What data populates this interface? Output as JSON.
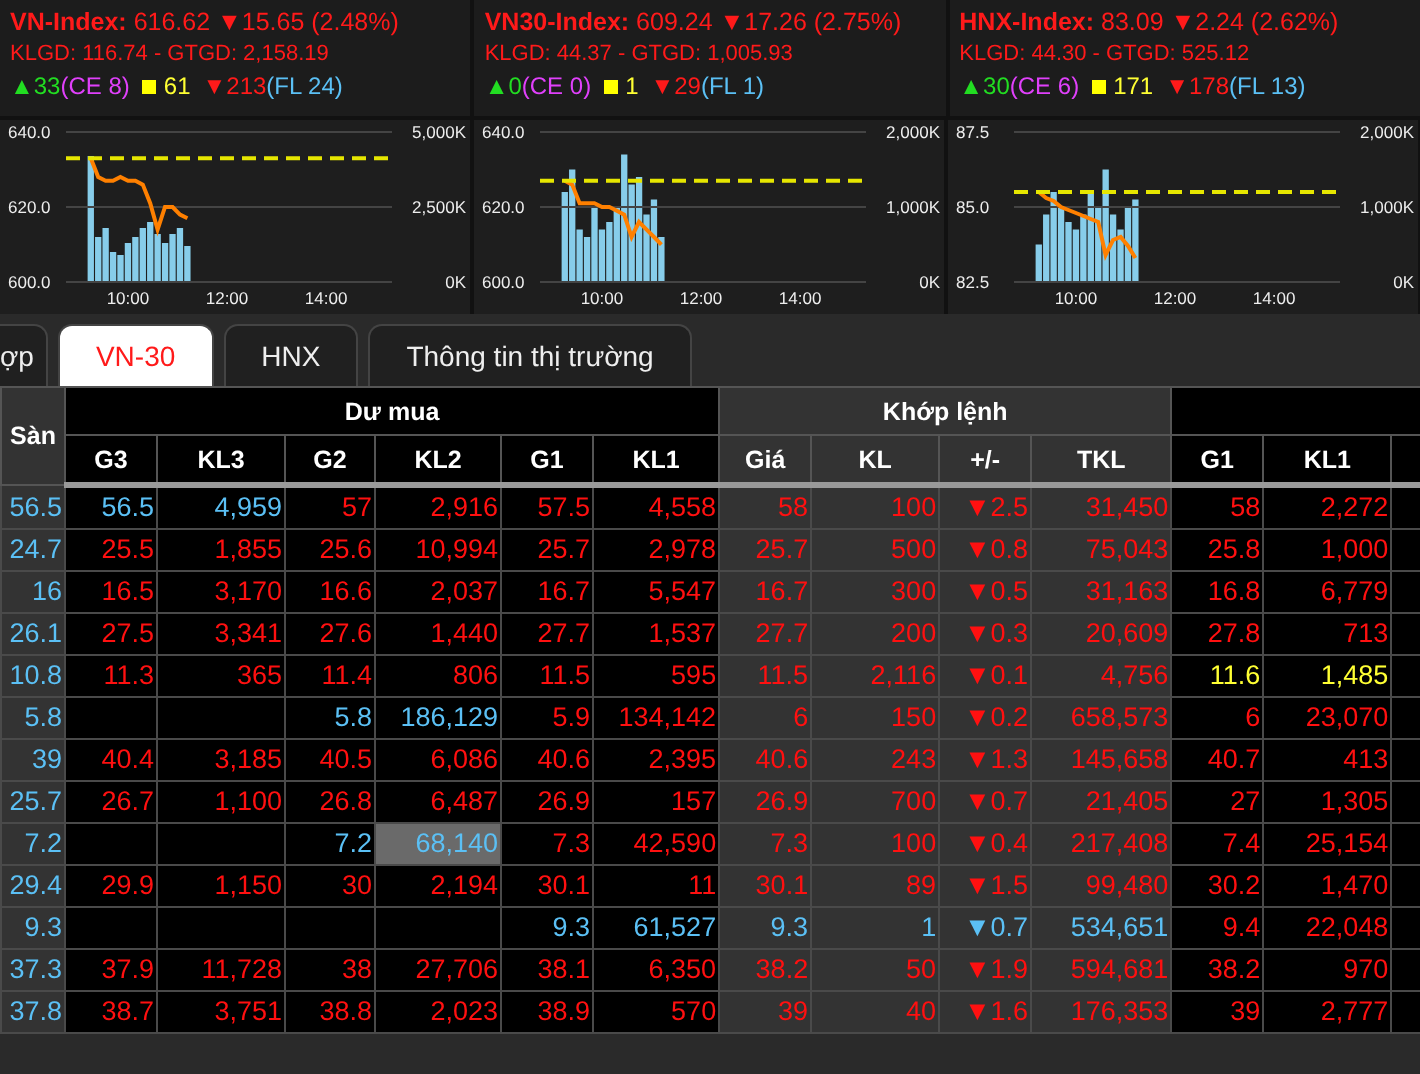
{
  "indices": [
    {
      "name": "VN-Index:",
      "value": "616.62",
      "change": "▼15.65 (2.48%)",
      "volume_line": "KLGD: 116.74 - GTGD: 2,158.19",
      "advances": "▲33",
      "ceiling": "(CE 8)",
      "unchanged": "61",
      "declines": "▼213",
      "floor": "(FL 24)"
    },
    {
      "name": "VN30-Index:",
      "value": "609.24",
      "change": "▼17.26 (2.75%)",
      "volume_line": "KLGD: 44.37 - GTGD: 1,005.93",
      "advances": "▲0",
      "ceiling": "(CE 0)",
      "unchanged": "1",
      "declines": "▼29",
      "floor": "(FL 1)"
    },
    {
      "name": "HNX-Index:",
      "value": "83.09",
      "change": "▼2.24 (2.62%)",
      "volume_line": "KLGD: 44.30 - GTGD: 525.12",
      "advances": "▲30",
      "ceiling": "(CE 6)",
      "unchanged": "171",
      "declines": "▼178",
      "floor": "(FL 13)"
    }
  ],
  "panels": [
    {
      "volume": {
        "chart_data": {
          "type": "bar",
          "x": [
            9.25,
            9.4,
            9.55,
            9.7,
            9.85,
            10.0,
            10.15,
            10.3,
            10.45,
            10.6,
            10.75,
            10.9,
            11.05,
            11.2
          ],
          "xlim": [
            8.75,
            15.33
          ],
          "ylim": [
            0,
            5000
          ],
          "yticks": [
            {
              "value": 0,
              "label": "0K"
            },
            {
              "value": 2500,
              "label": "2,500K"
            },
            {
              "value": 5000,
              "label": "5,000K"
            }
          ],
          "series": [
            {
              "color": "#87cdea",
              "values": [
                4200,
                1500,
                1800,
                1000,
                900,
                1300,
                1500,
                1800,
                2000,
                1600,
                1300,
                1600,
                1800,
                1200
              ]
            }
          ]
        }
      },
      "price": {
        "chart_data": {
          "type": "line",
          "x": [
            9.25,
            9.4,
            9.55,
            9.7,
            9.85,
            10.0,
            10.15,
            10.3,
            10.45,
            10.6,
            10.75,
            10.9,
            11.05,
            11.2
          ],
          "xlim": [
            8.75,
            15.33
          ],
          "ylim": [
            600,
            640
          ],
          "xticks": [
            {
              "value": 10,
              "label": "10:00"
            },
            {
              "value": 12,
              "label": "12:00"
            },
            {
              "value": 14,
              "label": "14:00"
            }
          ],
          "yticks": [
            {
              "value": 600,
              "label": "600.0"
            },
            {
              "value": 620,
              "label": "620.0"
            },
            {
              "value": 640,
              "label": "640.0"
            }
          ],
          "series": [
            {
              "color": "#ff8000",
              "values": [
                633,
                628,
                627,
                627,
                628,
                627,
                627,
                626,
                621,
                614,
                620,
                620,
                618,
                617
              ]
            }
          ]
        }
      }
    },
    {
      "volume": {
        "chart_data": {
          "type": "bar",
          "x": [
            9.25,
            9.4,
            9.55,
            9.7,
            9.85,
            10.0,
            10.15,
            10.3,
            10.45,
            10.6,
            10.75,
            10.9,
            11.05,
            11.2
          ],
          "xlim": [
            8.75,
            15.33
          ],
          "ylim": [
            0,
            2000
          ],
          "yticks": [
            {
              "value": 0,
              "label": "0K"
            },
            {
              "value": 1000,
              "label": "1,000K"
            },
            {
              "value": 2000,
              "label": "2,000K"
            }
          ],
          "series": [
            {
              "color": "#87cdea",
              "values": [
                1200,
                1500,
                700,
                600,
                1000,
                700,
                800,
                1000,
                1700,
                1300,
                1400,
                900,
                1100,
                600
              ]
            }
          ]
        }
      },
      "price": {
        "chart_data": {
          "type": "line",
          "x": [
            9.25,
            9.4,
            9.55,
            9.7,
            9.85,
            10.0,
            10.15,
            10.3,
            10.45,
            10.6,
            10.75,
            10.9,
            11.05,
            11.2
          ],
          "xlim": [
            8.75,
            15.33
          ],
          "ylim": [
            600,
            640
          ],
          "xticks": [
            {
              "value": 10,
              "label": "10:00"
            },
            {
              "value": 12,
              "label": "12:00"
            },
            {
              "value": 14,
              "label": "14:00"
            }
          ],
          "yticks": [
            {
              "value": 600,
              "label": "600.0"
            },
            {
              "value": 620,
              "label": "620.0"
            },
            {
              "value": 640,
              "label": "640.0"
            }
          ],
          "series": [
            {
              "color": "#ff8000",
              "values": [
                627,
                626,
                621,
                621,
                621,
                620,
                620,
                619,
                618,
                612,
                616,
                614,
                612,
                610
              ]
            }
          ]
        }
      }
    },
    {
      "volume": {
        "chart_data": {
          "type": "bar",
          "x": [
            9.25,
            9.4,
            9.55,
            9.7,
            9.85,
            10.0,
            10.15,
            10.3,
            10.45,
            10.6,
            10.75,
            10.9,
            11.05,
            11.2
          ],
          "xlim": [
            8.75,
            15.33
          ],
          "ylim": [
            0,
            2000
          ],
          "yticks": [
            {
              "value": 0,
              "label": "0K"
            },
            {
              "value": 1000,
              "label": "1,000K"
            },
            {
              "value": 2000,
              "label": "2,000K"
            }
          ],
          "series": [
            {
              "color": "#87cdea",
              "values": [
                500,
                900,
                1200,
                1000,
                800,
                700,
                900,
                1200,
                1000,
                1500,
                900,
                700,
                1000,
                1100
              ]
            }
          ]
        }
      },
      "price": {
        "chart_data": {
          "type": "line",
          "x": [
            9.25,
            9.4,
            9.55,
            9.7,
            9.85,
            10.0,
            10.15,
            10.3,
            10.45,
            10.6,
            10.75,
            10.9,
            11.05,
            11.2
          ],
          "xlim": [
            8.75,
            15.33
          ],
          "ylim": [
            82.5,
            87.5
          ],
          "xticks": [
            {
              "value": 10,
              "label": "10:00"
            },
            {
              "value": 12,
              "label": "12:00"
            },
            {
              "value": 14,
              "label": "14:00"
            }
          ],
          "yticks": [
            {
              "value": 82.5,
              "label": "82.5"
            },
            {
              "value": 85,
              "label": "85.0"
            },
            {
              "value": 87.5,
              "label": "87.5"
            }
          ],
          "series": [
            {
              "color": "#ff8000",
              "values": [
                85.5,
                85.3,
                85.2,
                85.0,
                84.9,
                84.8,
                84.7,
                84.6,
                84.5,
                83.4,
                83.9,
                84.0,
                83.7,
                83.3
              ]
            }
          ]
        }
      }
    }
  ],
  "tabs": [
    {
      "label": "ợp",
      "selected": false
    },
    {
      "label": "VN-30",
      "selected": true
    },
    {
      "label": "HNX",
      "selected": false
    },
    {
      "label": "Thông tin thị trường",
      "selected": false
    }
  ],
  "table": {
    "groups": [
      {
        "kind": "floor"
      },
      {
        "kind": "buy",
        "label": "Dư mua"
      },
      {
        "kind": "match",
        "label": "Khớp lệnh"
      },
      {
        "kind": "sell"
      }
    ],
    "columns": [
      {
        "label": "Sàn",
        "kind": "floor"
      },
      {
        "label": "G3",
        "kind": "buy"
      },
      {
        "label": "KL3",
        "kind": "buy"
      },
      {
        "label": "G2",
        "kind": "buy"
      },
      {
        "label": "KL2",
        "kind": "buy"
      },
      {
        "label": "G1",
        "kind": "buy"
      },
      {
        "label": "KL1",
        "kind": "buy"
      },
      {
        "label": "Giá",
        "kind": "match"
      },
      {
        "label": "KL",
        "kind": "match"
      },
      {
        "label": "+/-",
        "kind": "match"
      },
      {
        "label": "TKL",
        "kind": "match"
      },
      {
        "label": "G1",
        "kind": "sell"
      },
      {
        "label": "KL1",
        "kind": "sell"
      }
    ],
    "rows": [
      {
        "cells": [
          {
            "text": "56.5",
            "color": "#5bc0f5"
          },
          {
            "text": "56.5",
            "color": "#5bc0f5"
          },
          {
            "text": "4,959",
            "color": "#5bc0f5"
          },
          {
            "text": "57",
            "color": "#ff1010"
          },
          {
            "text": "2,916",
            "color": "#ff1010"
          },
          {
            "text": "57.5",
            "color": "#ff1010"
          },
          {
            "text": "4,558",
            "color": "#ff1010"
          },
          {
            "text": "58",
            "color": "#ff1010"
          },
          {
            "text": "100",
            "color": "#ff1010"
          },
          {
            "text": "▼2.5",
            "color": "#ff1010"
          },
          {
            "text": "31,450",
            "color": "#ff1010"
          },
          {
            "text": "58",
            "color": "#ff1010"
          },
          {
            "text": "2,272",
            "color": "#ff1010"
          }
        ]
      },
      {
        "cells": [
          {
            "text": "24.7",
            "color": "#5bc0f5"
          },
          {
            "text": "25.5",
            "color": "#ff1010"
          },
          {
            "text": "1,855",
            "color": "#ff1010"
          },
          {
            "text": "25.6",
            "color": "#ff1010"
          },
          {
            "text": "10,994",
            "color": "#ff1010"
          },
          {
            "text": "25.7",
            "color": "#ff1010"
          },
          {
            "text": "2,978",
            "color": "#ff1010"
          },
          {
            "text": "25.7",
            "color": "#ff1010"
          },
          {
            "text": "500",
            "color": "#ff1010"
          },
          {
            "text": "▼0.8",
            "color": "#ff1010"
          },
          {
            "text": "75,043",
            "color": "#ff1010"
          },
          {
            "text": "25.8",
            "color": "#ff1010"
          },
          {
            "text": "1,000",
            "color": "#ff1010"
          }
        ]
      },
      {
        "cells": [
          {
            "text": "16",
            "color": "#5bc0f5"
          },
          {
            "text": "16.5",
            "color": "#ff1010"
          },
          {
            "text": "3,170",
            "color": "#ff1010"
          },
          {
            "text": "16.6",
            "color": "#ff1010"
          },
          {
            "text": "2,037",
            "color": "#ff1010"
          },
          {
            "text": "16.7",
            "color": "#ff1010"
          },
          {
            "text": "5,547",
            "color": "#ff1010"
          },
          {
            "text": "16.7",
            "color": "#ff1010"
          },
          {
            "text": "300",
            "color": "#ff1010"
          },
          {
            "text": "▼0.5",
            "color": "#ff1010"
          },
          {
            "text": "31,163",
            "color": "#ff1010"
          },
          {
            "text": "16.8",
            "color": "#ff1010"
          },
          {
            "text": "6,779",
            "color": "#ff1010"
          }
        ]
      },
      {
        "cells": [
          {
            "text": "26.1",
            "color": "#5bc0f5"
          },
          {
            "text": "27.5",
            "color": "#ff1010"
          },
          {
            "text": "3,341",
            "color": "#ff1010"
          },
          {
            "text": "27.6",
            "color": "#ff1010"
          },
          {
            "text": "1,440",
            "color": "#ff1010"
          },
          {
            "text": "27.7",
            "color": "#ff1010"
          },
          {
            "text": "1,537",
            "color": "#ff1010"
          },
          {
            "text": "27.7",
            "color": "#ff1010"
          },
          {
            "text": "200",
            "color": "#ff1010"
          },
          {
            "text": "▼0.3",
            "color": "#ff1010"
          },
          {
            "text": "20,609",
            "color": "#ff1010"
          },
          {
            "text": "27.8",
            "color": "#ff1010"
          },
          {
            "text": "713",
            "color": "#ff1010"
          }
        ]
      },
      {
        "cells": [
          {
            "text": "10.8",
            "color": "#5bc0f5"
          },
          {
            "text": "11.3",
            "color": "#ff1010"
          },
          {
            "text": "365",
            "color": "#ff1010"
          },
          {
            "text": "11.4",
            "color": "#ff1010"
          },
          {
            "text": "806",
            "color": "#ff1010"
          },
          {
            "text": "11.5",
            "color": "#ff1010"
          },
          {
            "text": "595",
            "color": "#ff1010"
          },
          {
            "text": "11.5",
            "color": "#ff1010"
          },
          {
            "text": "2,116",
            "color": "#ff1010"
          },
          {
            "text": "▼0.1",
            "color": "#ff1010"
          },
          {
            "text": "4,756",
            "color": "#ff1010"
          },
          {
            "text": "11.6",
            "color": "#ffff33"
          },
          {
            "text": "1,485",
            "color": "#ffff33"
          }
        ]
      },
      {
        "cells": [
          {
            "text": "5.8",
            "color": "#5bc0f5"
          },
          null,
          null,
          {
            "text": "5.8",
            "color": "#5bc0f5"
          },
          {
            "text": "186,129",
            "color": "#5bc0f5"
          },
          {
            "text": "5.9",
            "color": "#ff1010"
          },
          {
            "text": "134,142",
            "color": "#ff1010"
          },
          {
            "text": "6",
            "color": "#ff1010"
          },
          {
            "text": "150",
            "color": "#ff1010"
          },
          {
            "text": "▼0.2",
            "color": "#ff1010"
          },
          {
            "text": "658,573",
            "color": "#ff1010"
          },
          {
            "text": "6",
            "color": "#ff1010"
          },
          {
            "text": "23,070",
            "color": "#ff1010"
          }
        ]
      },
      {
        "cells": [
          {
            "text": "39",
            "color": "#5bc0f5"
          },
          {
            "text": "40.4",
            "color": "#ff1010"
          },
          {
            "text": "3,185",
            "color": "#ff1010"
          },
          {
            "text": "40.5",
            "color": "#ff1010"
          },
          {
            "text": "6,086",
            "color": "#ff1010"
          },
          {
            "text": "40.6",
            "color": "#ff1010"
          },
          {
            "text": "2,395",
            "color": "#ff1010"
          },
          {
            "text": "40.6",
            "color": "#ff1010"
          },
          {
            "text": "243",
            "color": "#ff1010"
          },
          {
            "text": "▼1.3",
            "color": "#ff1010"
          },
          {
            "text": "145,658",
            "color": "#ff1010"
          },
          {
            "text": "40.7",
            "color": "#ff1010"
          },
          {
            "text": "413",
            "color": "#ff1010"
          }
        ]
      },
      {
        "cells": [
          {
            "text": "25.7",
            "color": "#5bc0f5"
          },
          {
            "text": "26.7",
            "color": "#ff1010"
          },
          {
            "text": "1,100",
            "color": "#ff1010"
          },
          {
            "text": "26.8",
            "color": "#ff1010"
          },
          {
            "text": "6,487",
            "color": "#ff1010"
          },
          {
            "text": "26.9",
            "color": "#ff1010"
          },
          {
            "text": "157",
            "color": "#ff1010"
          },
          {
            "text": "26.9",
            "color": "#ff1010"
          },
          {
            "text": "700",
            "color": "#ff1010"
          },
          {
            "text": "▼0.7",
            "color": "#ff1010"
          },
          {
            "text": "21,405",
            "color": "#ff1010"
          },
          {
            "text": "27",
            "color": "#ff1010"
          },
          {
            "text": "1,305",
            "color": "#ff1010"
          }
        ]
      },
      {
        "cells": [
          {
            "text": "7.2",
            "color": "#5bc0f5"
          },
          null,
          null,
          {
            "text": "7.2",
            "color": "#5bc0f5"
          },
          {
            "text": "68,140",
            "color": "#5bc0f5",
            "flash": true
          },
          {
            "text": "7.3",
            "color": "#ff1010"
          },
          {
            "text": "42,590",
            "color": "#ff1010"
          },
          {
            "text": "7.3",
            "color": "#ff1010"
          },
          {
            "text": "100",
            "color": "#ff1010"
          },
          {
            "text": "▼0.4",
            "color": "#ff1010"
          },
          {
            "text": "217,408",
            "color": "#ff1010"
          },
          {
            "text": "7.4",
            "color": "#ff1010"
          },
          {
            "text": "25,154",
            "color": "#ff1010"
          }
        ]
      },
      {
        "cells": [
          {
            "text": "29.4",
            "color": "#5bc0f5"
          },
          {
            "text": "29.9",
            "color": "#ff1010"
          },
          {
            "text": "1,150",
            "color": "#ff1010"
          },
          {
            "text": "30",
            "color": "#ff1010"
          },
          {
            "text": "2,194",
            "color": "#ff1010"
          },
          {
            "text": "30.1",
            "color": "#ff1010"
          },
          {
            "text": "11",
            "color": "#ff1010"
          },
          {
            "text": "30.1",
            "color": "#ff1010"
          },
          {
            "text": "89",
            "color": "#ff1010"
          },
          {
            "text": "▼1.5",
            "color": "#ff1010"
          },
          {
            "text": "99,480",
            "color": "#ff1010"
          },
          {
            "text": "30.2",
            "color": "#ff1010"
          },
          {
            "text": "1,470",
            "color": "#ff1010"
          }
        ]
      },
      {
        "cells": [
          {
            "text": "9.3",
            "color": "#5bc0f5"
          },
          null,
          null,
          null,
          null,
          {
            "text": "9.3",
            "color": "#5bc0f5"
          },
          {
            "text": "61,527",
            "color": "#5bc0f5"
          },
          {
            "text": "9.3",
            "color": "#5bc0f5"
          },
          {
            "text": "1",
            "color": "#5bc0f5"
          },
          {
            "text": "▼0.7",
            "color": "#5bc0f5"
          },
          {
            "text": "534,651",
            "color": "#5bc0f5"
          },
          {
            "text": "9.4",
            "color": "#ff1010"
          },
          {
            "text": "22,048",
            "color": "#ff1010"
          }
        ]
      },
      {
        "cells": [
          {
            "text": "37.3",
            "color": "#5bc0f5"
          },
          {
            "text": "37.9",
            "color": "#ff1010"
          },
          {
            "text": "11,728",
            "color": "#ff1010"
          },
          {
            "text": "38",
            "color": "#ff1010"
          },
          {
            "text": "27,706",
            "color": "#ff1010"
          },
          {
            "text": "38.1",
            "color": "#ff1010"
          },
          {
            "text": "6,350",
            "color": "#ff1010"
          },
          {
            "text": "38.2",
            "color": "#ff1010"
          },
          {
            "text": "50",
            "color": "#ff1010"
          },
          {
            "text": "▼1.9",
            "color": "#ff1010"
          },
          {
            "text": "594,681",
            "color": "#ff1010"
          },
          {
            "text": "38.2",
            "color": "#ff1010"
          },
          {
            "text": "970",
            "color": "#ff1010"
          }
        ]
      },
      {
        "cells": [
          {
            "text": "37.8",
            "color": "#5bc0f5"
          },
          {
            "text": "38.7",
            "color": "#ff1010"
          },
          {
            "text": "3,751",
            "color": "#ff1010"
          },
          {
            "text": "38.8",
            "color": "#ff1010"
          },
          {
            "text": "2,023",
            "color": "#ff1010"
          },
          {
            "text": "38.9",
            "color": "#ff1010"
          },
          {
            "text": "570",
            "color": "#ff1010"
          },
          {
            "text": "39",
            "color": "#ff1010"
          },
          {
            "text": "40",
            "color": "#ff1010"
          },
          {
            "text": "▼1.6",
            "color": "#ff1010"
          },
          {
            "text": "176,353",
            "color": "#ff1010"
          },
          {
            "text": "39",
            "color": "#ff1010"
          },
          {
            "text": "2,777",
            "color": "#ff1010"
          }
        ]
      }
    ]
  }
}
